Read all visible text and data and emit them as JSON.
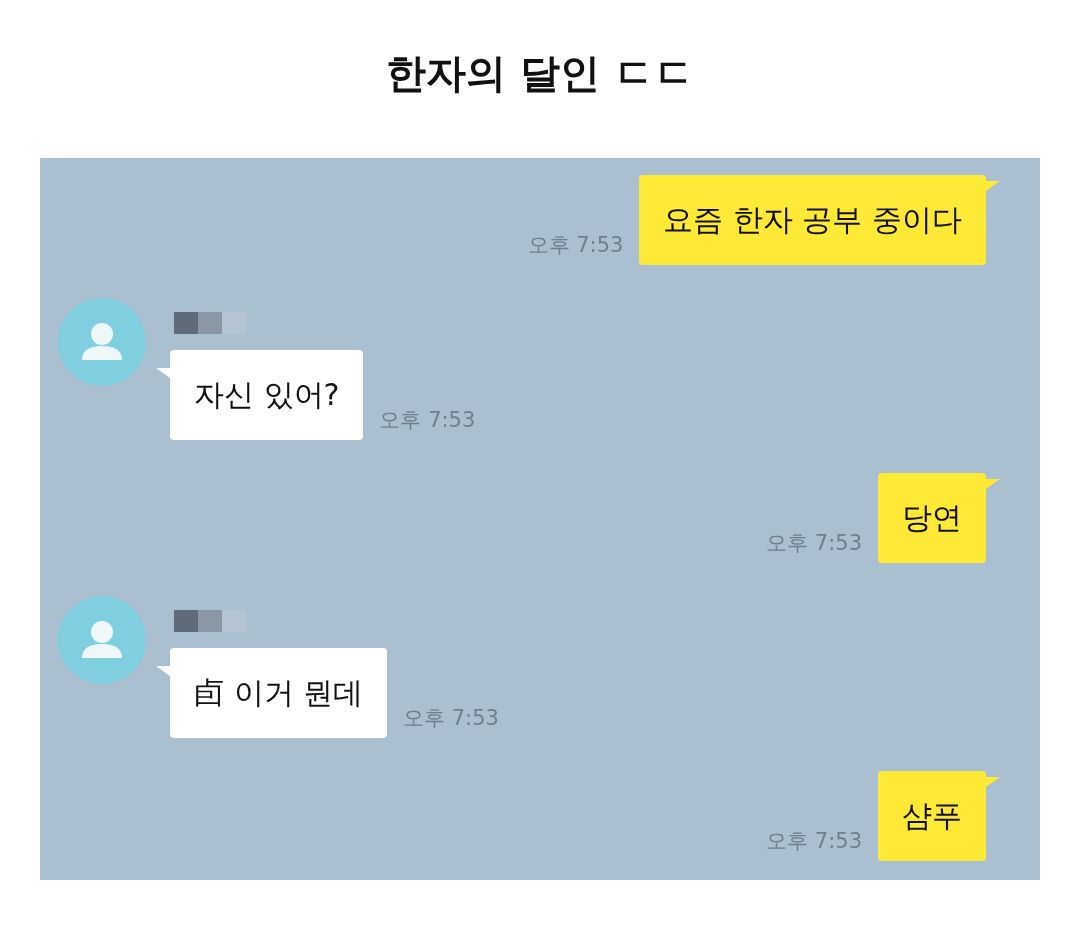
{
  "title": "한자의 달인 ㄷㄷ",
  "messages": [
    {
      "kind": "sent",
      "text": "요즘 한자 공부 중이다",
      "time": "오후 7:53"
    },
    {
      "kind": "received",
      "text": "자신 있어?",
      "time": "오후 7:53"
    },
    {
      "kind": "sent",
      "text": "당연",
      "time": "오후 7:53"
    },
    {
      "kind": "received",
      "text": "卣 이거 뭔데",
      "time": "오후 7:53"
    },
    {
      "kind": "sent",
      "text": "샴푸",
      "time": "오후 7:53"
    }
  ]
}
